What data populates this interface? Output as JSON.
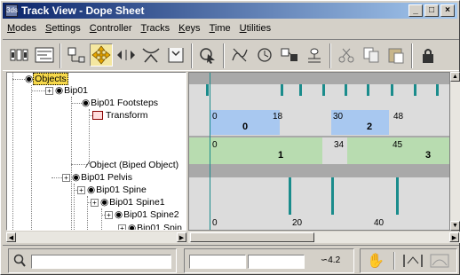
{
  "window": {
    "title": "Track View - Dope Sheet",
    "app_icon": "3ds",
    "min": "_",
    "max": "□",
    "close": "×"
  },
  "menu": [
    {
      "label": "Modes",
      "u": "M"
    },
    {
      "label": "Settings",
      "u": "S"
    },
    {
      "label": "Controller",
      "u": "C"
    },
    {
      "label": "Tracks",
      "u": "T"
    },
    {
      "label": "Keys",
      "u": "K"
    },
    {
      "label": "Time",
      "u": "T"
    },
    {
      "label": "Utilities",
      "u": "U"
    }
  ],
  "tree": {
    "objects": "Objects",
    "bip01": "Bip01",
    "footsteps": "Bip01 Footsteps",
    "transform": "Transform",
    "object_biped": "Object (Biped Object)",
    "pelvis": "Bip01 Pelvis",
    "spine": "Bip01 Spine",
    "spine1": "Bip01 Spine1",
    "spine2": "Bip01 Spine2",
    "spine_partial": "Bip01 Spin"
  },
  "dope": {
    "blue_row": {
      "n1": "0",
      "n2": "18",
      "n3": "30",
      "n4": "48",
      "big1": "0",
      "big2": "2"
    },
    "green_row": {
      "n1": "0",
      "n2": "34",
      "n3": "45",
      "big1": "1",
      "big2": "3"
    },
    "ruler": {
      "t0": "0",
      "t20": "20",
      "t40": "40"
    }
  },
  "status": {
    "zoom_value": "4.2"
  },
  "colors": {
    "title_start": "#0a246a",
    "title_end": "#a6caf0",
    "key": "#1a8c8c",
    "blue_range": "#a8c8f0",
    "green_range": "#b8dcb0",
    "selected": "#f6d84a"
  }
}
